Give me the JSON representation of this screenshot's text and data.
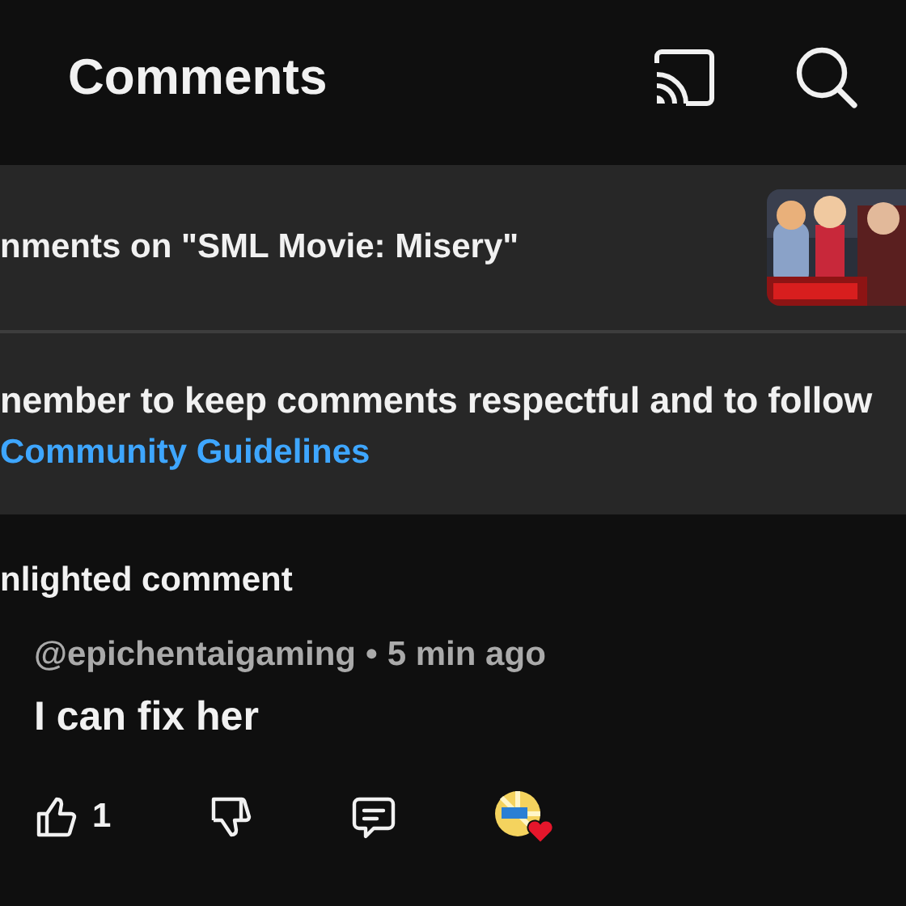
{
  "header": {
    "title": "Comments"
  },
  "video": {
    "title": "nments on \"SML Movie: Misery\""
  },
  "notice": {
    "text": "nember to keep comments respectful and to follow",
    "link": "Community Guidelines"
  },
  "section_title": "nlighted comment",
  "comment": {
    "author": "@epichentaigaming",
    "separator": "•",
    "time": "5 min ago",
    "text": "I can fix her",
    "likes": "1",
    "liked": false,
    "disliked": false,
    "hearted": true
  }
}
